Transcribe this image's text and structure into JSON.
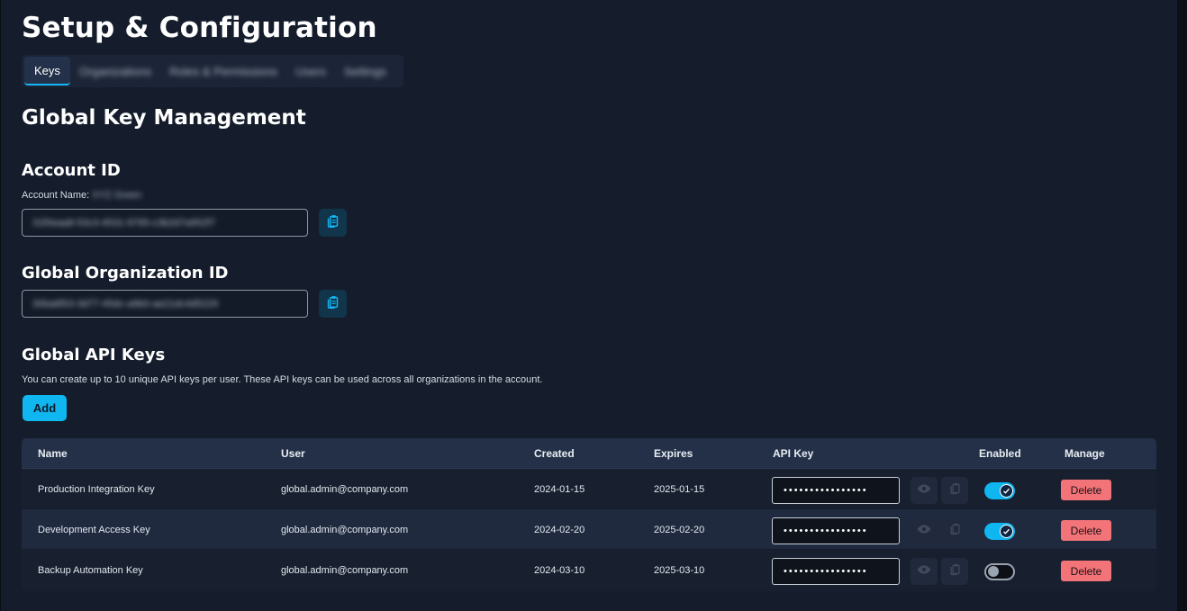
{
  "page": {
    "title": "Setup & Configuration",
    "tabs": [
      {
        "label": "Keys",
        "active": true
      },
      {
        "label": "Organizations",
        "active": false
      },
      {
        "label": "Roles & Permissions",
        "active": false
      },
      {
        "label": "Users",
        "active": false
      },
      {
        "label": "Settings",
        "active": false
      }
    ],
    "section_title": "Global Key Management"
  },
  "account": {
    "heading": "Account ID",
    "name_label": "Account Name:",
    "name_value": "XYZ Green",
    "id_value": "31f0eaa8-53c3-4531-9765-c3b2d7a952f7",
    "copy_icon": "clipboard-icon"
  },
  "organization": {
    "heading": "Global Organization ID",
    "id_value": "30ba6f03-3d77-45dc-a9b0-ae21dc4d5229",
    "copy_icon": "clipboard-icon"
  },
  "api_keys": {
    "heading": "Global API Keys",
    "description": "You can create up to 10 unique API keys per user. These API keys can be used across all organizations in the account.",
    "add_label": "Add",
    "columns": {
      "name": "Name",
      "user": "User",
      "created": "Created",
      "expires": "Expires",
      "api_key": "API Key",
      "enabled": "Enabled",
      "manage": "Manage"
    },
    "rows": [
      {
        "name": "Production Integration Key",
        "user": "global.admin@company.com",
        "created": "2024-01-15",
        "expires": "2025-01-15",
        "masked_key": "••••••••••••••••",
        "enabled": true,
        "delete_label": "Delete"
      },
      {
        "name": "Development Access Key",
        "user": "global.admin@company.com",
        "created": "2024-02-20",
        "expires": "2025-02-20",
        "masked_key": "••••••••••••••••",
        "enabled": true,
        "delete_label": "Delete"
      },
      {
        "name": "Backup Automation Key",
        "user": "global.admin@company.com",
        "created": "2024-03-10",
        "expires": "2025-03-10",
        "masked_key": "••••••••••••••••",
        "enabled": false,
        "delete_label": "Delete"
      }
    ]
  },
  "colors": {
    "accent": "#10b6f0",
    "danger": "#f27378",
    "background": "#151d2c"
  }
}
